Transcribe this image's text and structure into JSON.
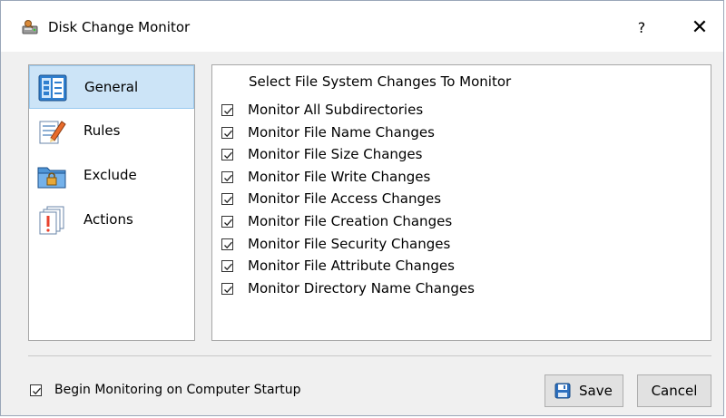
{
  "window": {
    "title": "Disk Change Monitor",
    "help_label": "?",
    "close_label": "✕",
    "title_icon": "disk-monitor-icon"
  },
  "nav": {
    "items": [
      {
        "label": "General",
        "icon": "general-list-icon",
        "selected": true
      },
      {
        "label": "Rules",
        "icon": "rules-edit-icon",
        "selected": false
      },
      {
        "label": "Exclude",
        "icon": "exclude-lock-folder-icon",
        "selected": false
      },
      {
        "label": "Actions",
        "icon": "actions-pages-icon",
        "selected": false
      }
    ]
  },
  "panel": {
    "heading": "Select File System Changes To Monitor",
    "options": [
      {
        "label": "Monitor All Subdirectories",
        "checked": true
      },
      {
        "label": "Monitor File Name Changes",
        "checked": true
      },
      {
        "label": "Monitor File Size Changes",
        "checked": true
      },
      {
        "label": "Monitor File Write Changes",
        "checked": true
      },
      {
        "label": "Monitor File Access Changes",
        "checked": true
      },
      {
        "label": "Monitor File Creation Changes",
        "checked": true
      },
      {
        "label": "Monitor File Security Changes",
        "checked": true
      },
      {
        "label": "Monitor File Attribute Changes",
        "checked": true
      },
      {
        "label": "Monitor Directory Name Changes",
        "checked": true
      }
    ]
  },
  "footer": {
    "startup_label": "Begin Monitoring on Computer Startup",
    "startup_checked": true,
    "save_label": "Save",
    "cancel_label": "Cancel"
  },
  "colors": {
    "selected_bg": "#cce4f7",
    "selected_border": "#99c9ef",
    "save_icon": "#2c6fbf"
  }
}
